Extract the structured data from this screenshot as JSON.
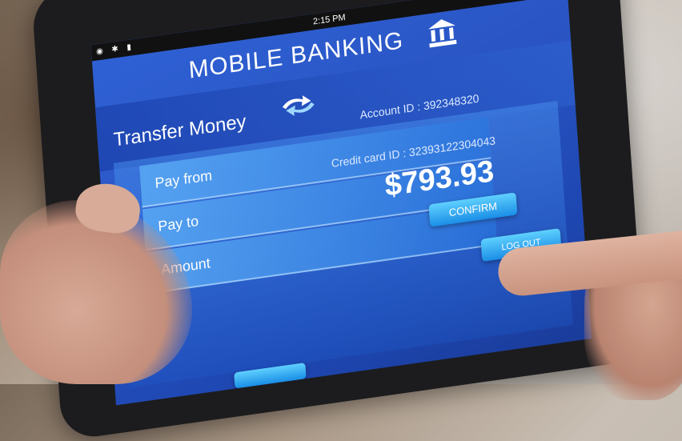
{
  "status_bar": {
    "time": "2:15 PM",
    "icons": [
      "location-icon",
      "bluetooth-icon",
      "battery-icon"
    ]
  },
  "app": {
    "title": "MOBILE BANKING",
    "icon": "bank-icon"
  },
  "transfer": {
    "title": "Transfer Money",
    "icon": "swap-arrows-icon",
    "account_id": "Account ID : 392348320",
    "credit_card_id": "Credit card ID : 32393122304043",
    "fields": {
      "pay_from": "Pay from",
      "pay_to": "Pay to",
      "amount": "Amount"
    },
    "amount_value": "$793.93"
  },
  "buttons": {
    "confirm": "CONFIRM",
    "logout": "LOG OUT"
  },
  "colors": {
    "screen_blue": "#2f62d6",
    "button_cyan": "#1a8ee6"
  }
}
